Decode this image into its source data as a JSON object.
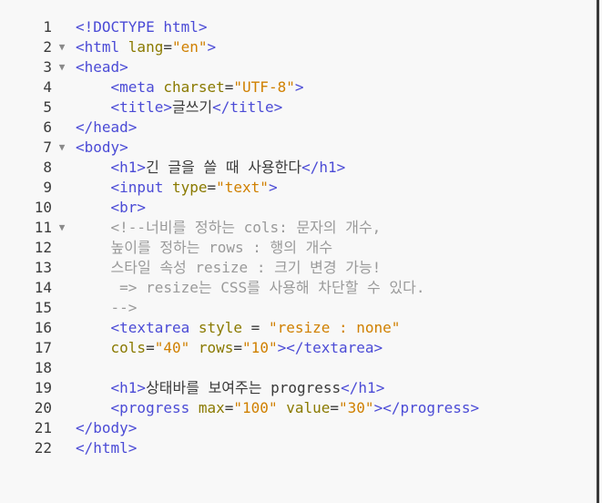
{
  "editor": {
    "lines": [
      {
        "n": "1",
        "fold": "",
        "indent": "",
        "tokens": [
          [
            "tag",
            "<!DOCTYPE html>"
          ]
        ]
      },
      {
        "n": "2",
        "fold": "▼",
        "indent": "",
        "tokens": [
          [
            "tag",
            "<html "
          ],
          [
            "attr",
            "lang"
          ],
          [
            "txt",
            "="
          ],
          [
            "str",
            "\"en\""
          ],
          [
            "tag",
            ">"
          ]
        ]
      },
      {
        "n": "3",
        "fold": "▼",
        "indent": "",
        "tokens": [
          [
            "tag",
            "<head>"
          ]
        ]
      },
      {
        "n": "4",
        "fold": "",
        "indent": "    ",
        "tokens": [
          [
            "tag",
            "<meta "
          ],
          [
            "attr",
            "charset"
          ],
          [
            "txt",
            "="
          ],
          [
            "str",
            "\"UTF-8\""
          ],
          [
            "tag",
            ">"
          ]
        ]
      },
      {
        "n": "5",
        "fold": "",
        "indent": "    ",
        "tokens": [
          [
            "tag",
            "<title>"
          ],
          [
            "txt",
            "글쓰기"
          ],
          [
            "tag",
            "</title>"
          ]
        ]
      },
      {
        "n": "6",
        "fold": "",
        "indent": "",
        "tokens": [
          [
            "tag",
            "</head>"
          ]
        ]
      },
      {
        "n": "7",
        "fold": "▼",
        "indent": "",
        "tokens": [
          [
            "tag",
            "<body>"
          ]
        ]
      },
      {
        "n": "8",
        "fold": "",
        "indent": "    ",
        "tokens": [
          [
            "tag",
            "<h1>"
          ],
          [
            "txt",
            "긴 글을 쓸 때 사용한다"
          ],
          [
            "tag",
            "</h1>"
          ]
        ]
      },
      {
        "n": "9",
        "fold": "",
        "indent": "    ",
        "tokens": [
          [
            "tag",
            "<input "
          ],
          [
            "attr",
            "type"
          ],
          [
            "txt",
            "="
          ],
          [
            "str",
            "\"text\""
          ],
          [
            "tag",
            ">"
          ]
        ]
      },
      {
        "n": "10",
        "fold": "",
        "indent": "    ",
        "tokens": [
          [
            "tag",
            "<br>"
          ]
        ]
      },
      {
        "n": "11",
        "fold": "▼",
        "indent": "    ",
        "tokens": [
          [
            "cmt",
            "<!--너비를 정하는 cols: 문자의 개수,"
          ]
        ]
      },
      {
        "n": "12",
        "fold": "",
        "indent": "    ",
        "tokens": [
          [
            "cmt",
            "높이를 정하는 rows : 행의 개수"
          ]
        ]
      },
      {
        "n": "13",
        "fold": "",
        "indent": "    ",
        "tokens": [
          [
            "cmt",
            "스타일 속성 resize : 크기 변경 가능!"
          ]
        ]
      },
      {
        "n": "14",
        "fold": "",
        "indent": "    ",
        "tokens": [
          [
            "cmt",
            " => resize는 CSS를 사용해 차단할 수 있다."
          ]
        ]
      },
      {
        "n": "15",
        "fold": "",
        "indent": "    ",
        "tokens": [
          [
            "cmt",
            "-->"
          ]
        ]
      },
      {
        "n": "16",
        "fold": "",
        "indent": "    ",
        "tokens": [
          [
            "tag",
            "<textarea "
          ],
          [
            "attr",
            "style"
          ],
          [
            "txt",
            " = "
          ],
          [
            "str",
            "\"resize : none\""
          ]
        ]
      },
      {
        "n": "17",
        "fold": "",
        "indent": "    ",
        "tokens": [
          [
            "attr",
            "cols"
          ],
          [
            "txt",
            "="
          ],
          [
            "str",
            "\"40\""
          ],
          [
            "txt",
            " "
          ],
          [
            "attr",
            "rows"
          ],
          [
            "txt",
            "="
          ],
          [
            "str",
            "\"10\""
          ],
          [
            "tag",
            "></textarea>"
          ]
        ]
      },
      {
        "n": "18",
        "fold": "",
        "indent": "",
        "tokens": []
      },
      {
        "n": "19",
        "fold": "",
        "indent": "    ",
        "tokens": [
          [
            "tag",
            "<h1>"
          ],
          [
            "txt",
            "상태바를 보여주는 progress"
          ],
          [
            "tag",
            "</h1>"
          ]
        ]
      },
      {
        "n": "20",
        "fold": "",
        "indent": "    ",
        "tokens": [
          [
            "tag",
            "<progress "
          ],
          [
            "attr",
            "max"
          ],
          [
            "txt",
            "="
          ],
          [
            "str",
            "\"100\""
          ],
          [
            "txt",
            " "
          ],
          [
            "attr",
            "value"
          ],
          [
            "txt",
            "="
          ],
          [
            "str",
            "\"30\""
          ],
          [
            "tag",
            "></progress>"
          ]
        ]
      },
      {
        "n": "21",
        "fold": "",
        "indent": "",
        "tokens": [
          [
            "tag",
            "</body>"
          ]
        ]
      },
      {
        "n": "22",
        "fold": "",
        "indent": "",
        "tokens": [
          [
            "tag",
            "</html>"
          ]
        ]
      }
    ]
  },
  "colors": {
    "background": "#f8f8f8",
    "tag": "#4b4bd6",
    "attribute": "#8a7a00",
    "string": "#d08000",
    "comment": "#9a9a9a",
    "line_number": "#3b3b3b"
  }
}
